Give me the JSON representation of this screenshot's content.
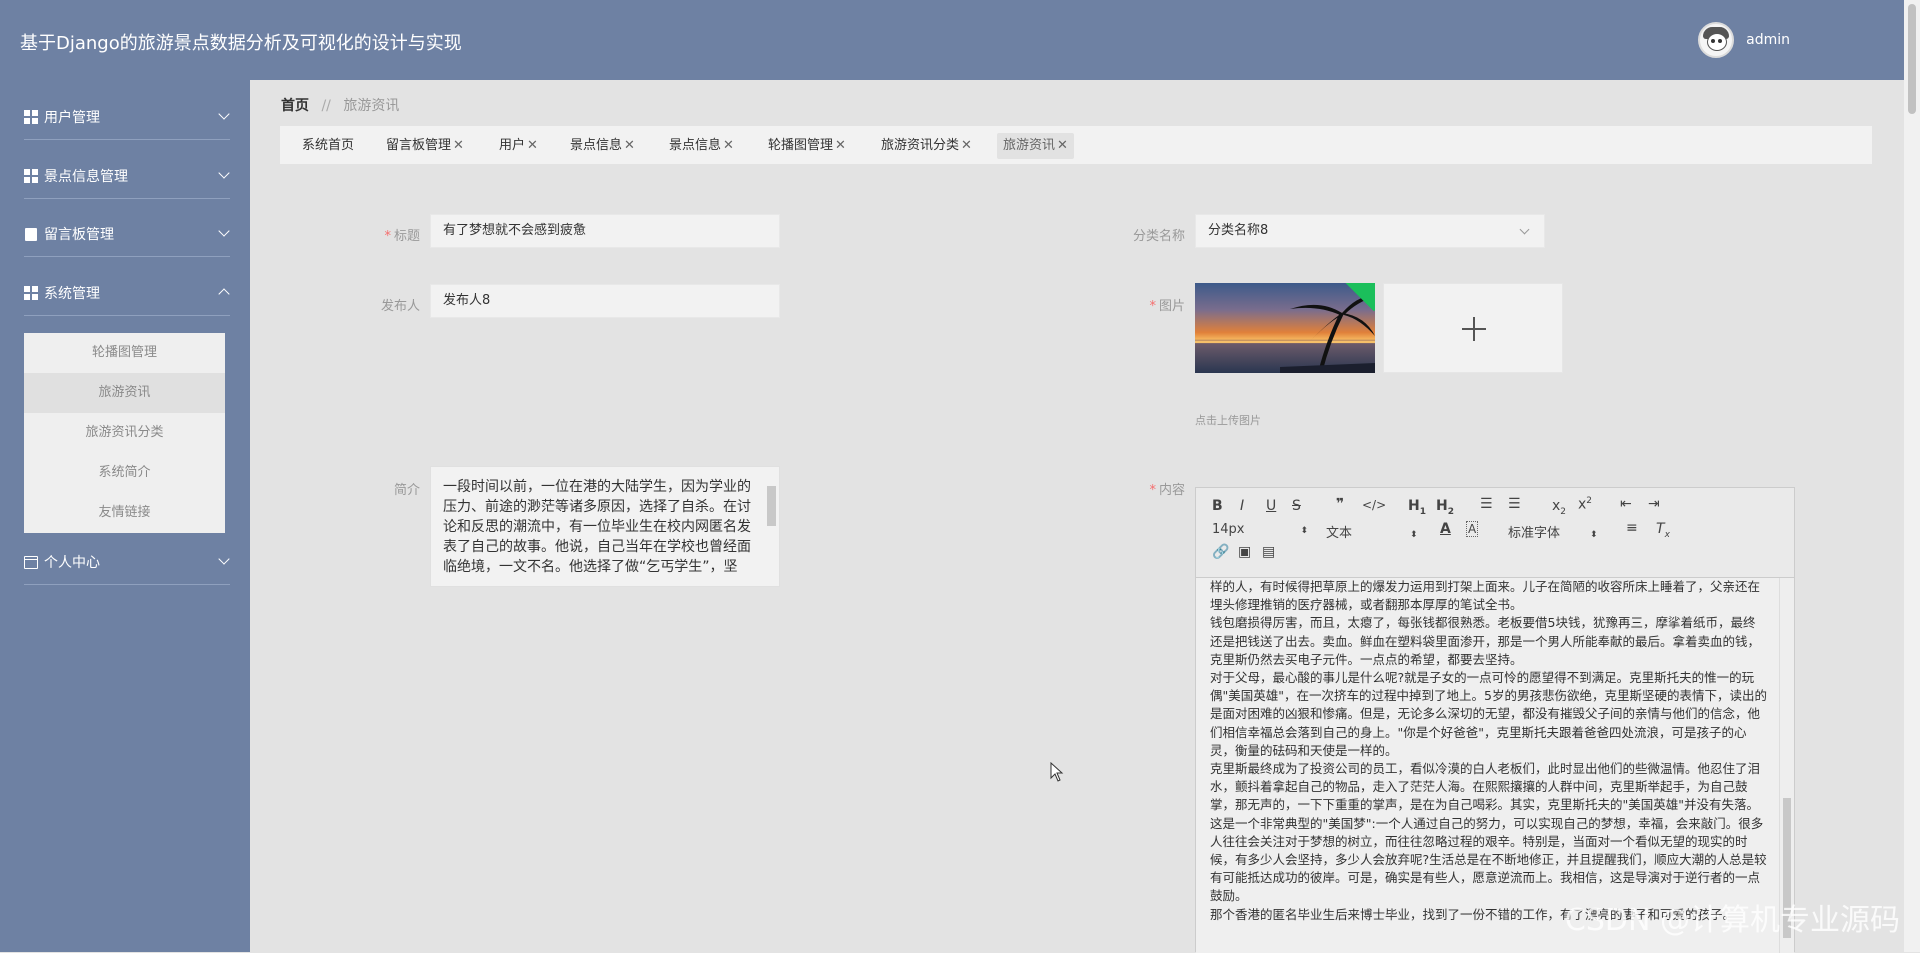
{
  "app": {
    "title": "基于Django的旅游景点数据分析及可视化的设计与实现",
    "username": "admin"
  },
  "sidebar": {
    "items": [
      {
        "label": "用户管理",
        "icon": "grid-icon"
      },
      {
        "label": "景点信息管理",
        "icon": "grid-icon"
      },
      {
        "label": "留言板管理",
        "icon": "clipboard-icon"
      },
      {
        "label": "系统管理",
        "icon": "grid-icon"
      },
      {
        "label": "个人中心",
        "icon": "card-icon"
      }
    ],
    "submenu": [
      "轮播图管理",
      "旅游资讯",
      "旅游资讯分类",
      "系统简介",
      "友情链接"
    ]
  },
  "breadcrumb": {
    "home": "首页",
    "separator": "//",
    "current": "旅游资讯"
  },
  "tabs": [
    "系统首页",
    "留言板管理",
    "用户",
    "景点信息",
    "景点信息",
    "轮播图管理",
    "旅游资讯分类",
    "旅游资讯"
  ],
  "form": {
    "title_label": "标题",
    "title_value": "有了梦想就不会感到疲惫",
    "category_label": "分类名称",
    "category_value": "分类名称8",
    "publisher_label": "发布人",
    "publisher_value": "发布人8",
    "image_label": "图片",
    "upload_hint": "点击上传图片",
    "summary_label": "简介",
    "summary_text": "一段时间以前，一位在港的大陆学生，因为学业的压力、前途的渺茫等诸多原因，选择了自杀。在讨论和反思的潮流中，有一位毕业生在校内网匿名发表了自己的故事。他说，自己当年在学校也曾经面临绝境，一文不名。他选择了做“乞丐学生”，坚",
    "content_label": "内容"
  },
  "editor": {
    "font_size": "14px",
    "block_type": "文本",
    "font_family": "标准字体",
    "content": "样的人，有时候得把草原上的爆发力运用到打架上面来。儿子在简陋的收容所床上睡着了，父亲还在埋头修理推销的医疗器械，或者翻那本厚厚的笔试全书。\n钱包磨损得厉害，而且，太瘪了，每张钱都很熟悉。老板要借5块钱，犹豫再三，摩挲着纸币，最终还是把钱送了出去。卖血。鲜血在塑料袋里面渗开，那是一个男人所能奉献的最后。拿着卖血的钱，克里斯仍然去买电子元件。一点点的希望，都要去坚持。\n对于父母，最心酸的事儿是什么呢?就是子女的一点可怜的愿望得不到满足。克里斯托夫的惟一的玩偶\"美国英雄\"，在一次挤车的过程中掉到了地上。5岁的男孩悲伤欲绝，克里斯坚硬的表情下，读出的是面对困难的凶狠和惨痛。但是，无论多么深切的无望，都没有摧毁父子间的亲情与他们的信念，他们相信幸福总会落到自己的身上。\"你是个好爸爸\"，克里斯托夫跟着爸爸四处流浪，可是孩子的心灵，衡量的砝码和天使是一样的。\n克里斯最终成为了投资公司的员工，看似冷漠的白人老板们，此时显出他们的些微温情。他忍住了泪水，颤抖着拿起自己的物品，走入了茫茫人海。在熙熙攘攘的人群中间，克里斯举起手，为自己鼓掌，那无声的，一下下重重的掌声，是在为自己喝彩。其实，克里斯托夫的\"美国英雄\"并没有失落。\n这是一个非常典型的\"美国梦\":一个人通过自己的努力，可以实现自己的梦想，幸福，会来敲门。很多人往往会关注对于梦想的树立，而往往忽略过程的艰辛。特别是，当面对一个看似无望的现实的时候，有多少人会坚持，多少人会放弃呢?生活总是在不断地修正，并且提醒我们，顺应大潮的人总是较有可能抵达成功的彼岸。可是，确实是有些人，愿意逆流而上。我相信，这是导演对于逆行者的一点鼓励。\n那个香港的匿名毕业生后来博士毕业，找到了一份不错的工作，有了漂亮的妻子和可爱的孩子。"
  },
  "watermark": "CSDN @计算机专业源码",
  "colors": {
    "sidebar": "#6e81a3",
    "required": "#f56c6c",
    "upload_success": "#1bbf5b"
  }
}
